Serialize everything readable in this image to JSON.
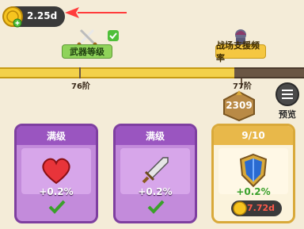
{
  "currency": {
    "value": "2.25d",
    "icon": "gold-coin-icon"
  },
  "milestones": [
    {
      "label": "武器等级",
      "completed": true,
      "icon": "crossed-swords-icon"
    },
    {
      "label": "战场支援频率",
      "completed": false,
      "icon": "knight-icon"
    }
  ],
  "progress": {
    "ticks": [
      "76阶",
      "77阶"
    ],
    "level_badge": "2309"
  },
  "preview_button": {
    "label": "预览",
    "icon": "list-menu-icon"
  },
  "cards": [
    {
      "header": "满级",
      "bonus": "+0.2%",
      "icon": "heart-icon",
      "status": "maxed"
    },
    {
      "header": "满级",
      "bonus": "+0.2%",
      "icon": "sword-icon",
      "status": "maxed"
    },
    {
      "header": "9/10",
      "bonus": "+0.2%",
      "icon": "shield-icon",
      "status": "upgradeable",
      "cost": "7.72d"
    }
  ],
  "colors": {
    "purple_card": "#c38bdb",
    "gold_card": "#fbf3dc",
    "progress_fill": "#f3d14a",
    "cost_text": "#ff5a4a"
  }
}
